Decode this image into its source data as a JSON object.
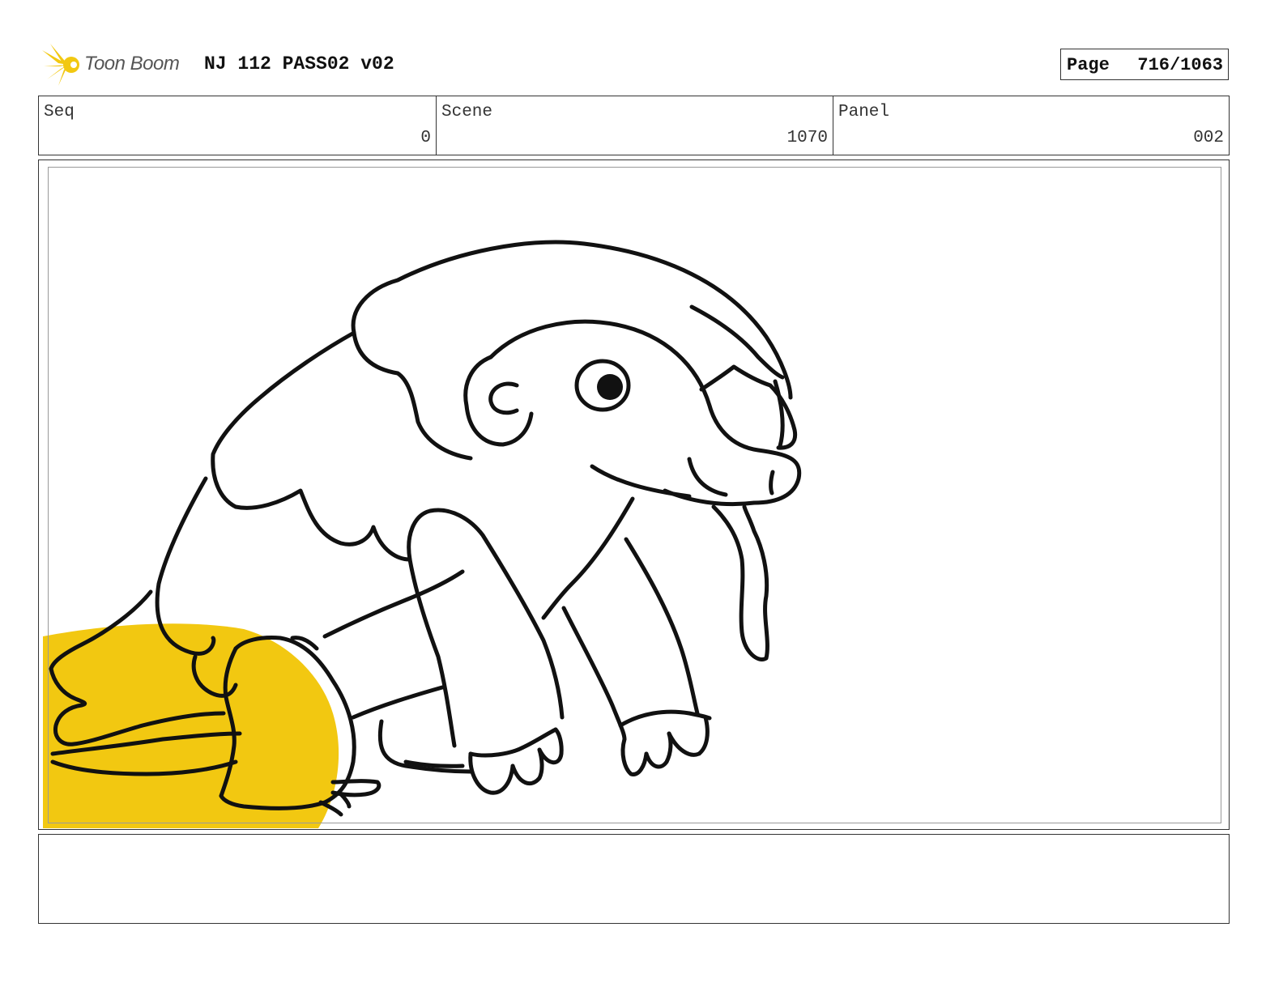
{
  "header": {
    "logo_text": "Toon Boom",
    "project_title": "NJ 112 PASS02 v02",
    "page_label": "Page",
    "page_number": "716/1063"
  },
  "info": {
    "seq": {
      "label": "Seq",
      "value": "0"
    },
    "scene": {
      "label": "Scene",
      "value": "1070"
    },
    "panel": {
      "label": "Panel",
      "value": "002"
    }
  },
  "colors": {
    "accent_yellow": "#F2C811",
    "line": "#111111",
    "border": "#333333"
  },
  "caption": {
    "text": ""
  }
}
